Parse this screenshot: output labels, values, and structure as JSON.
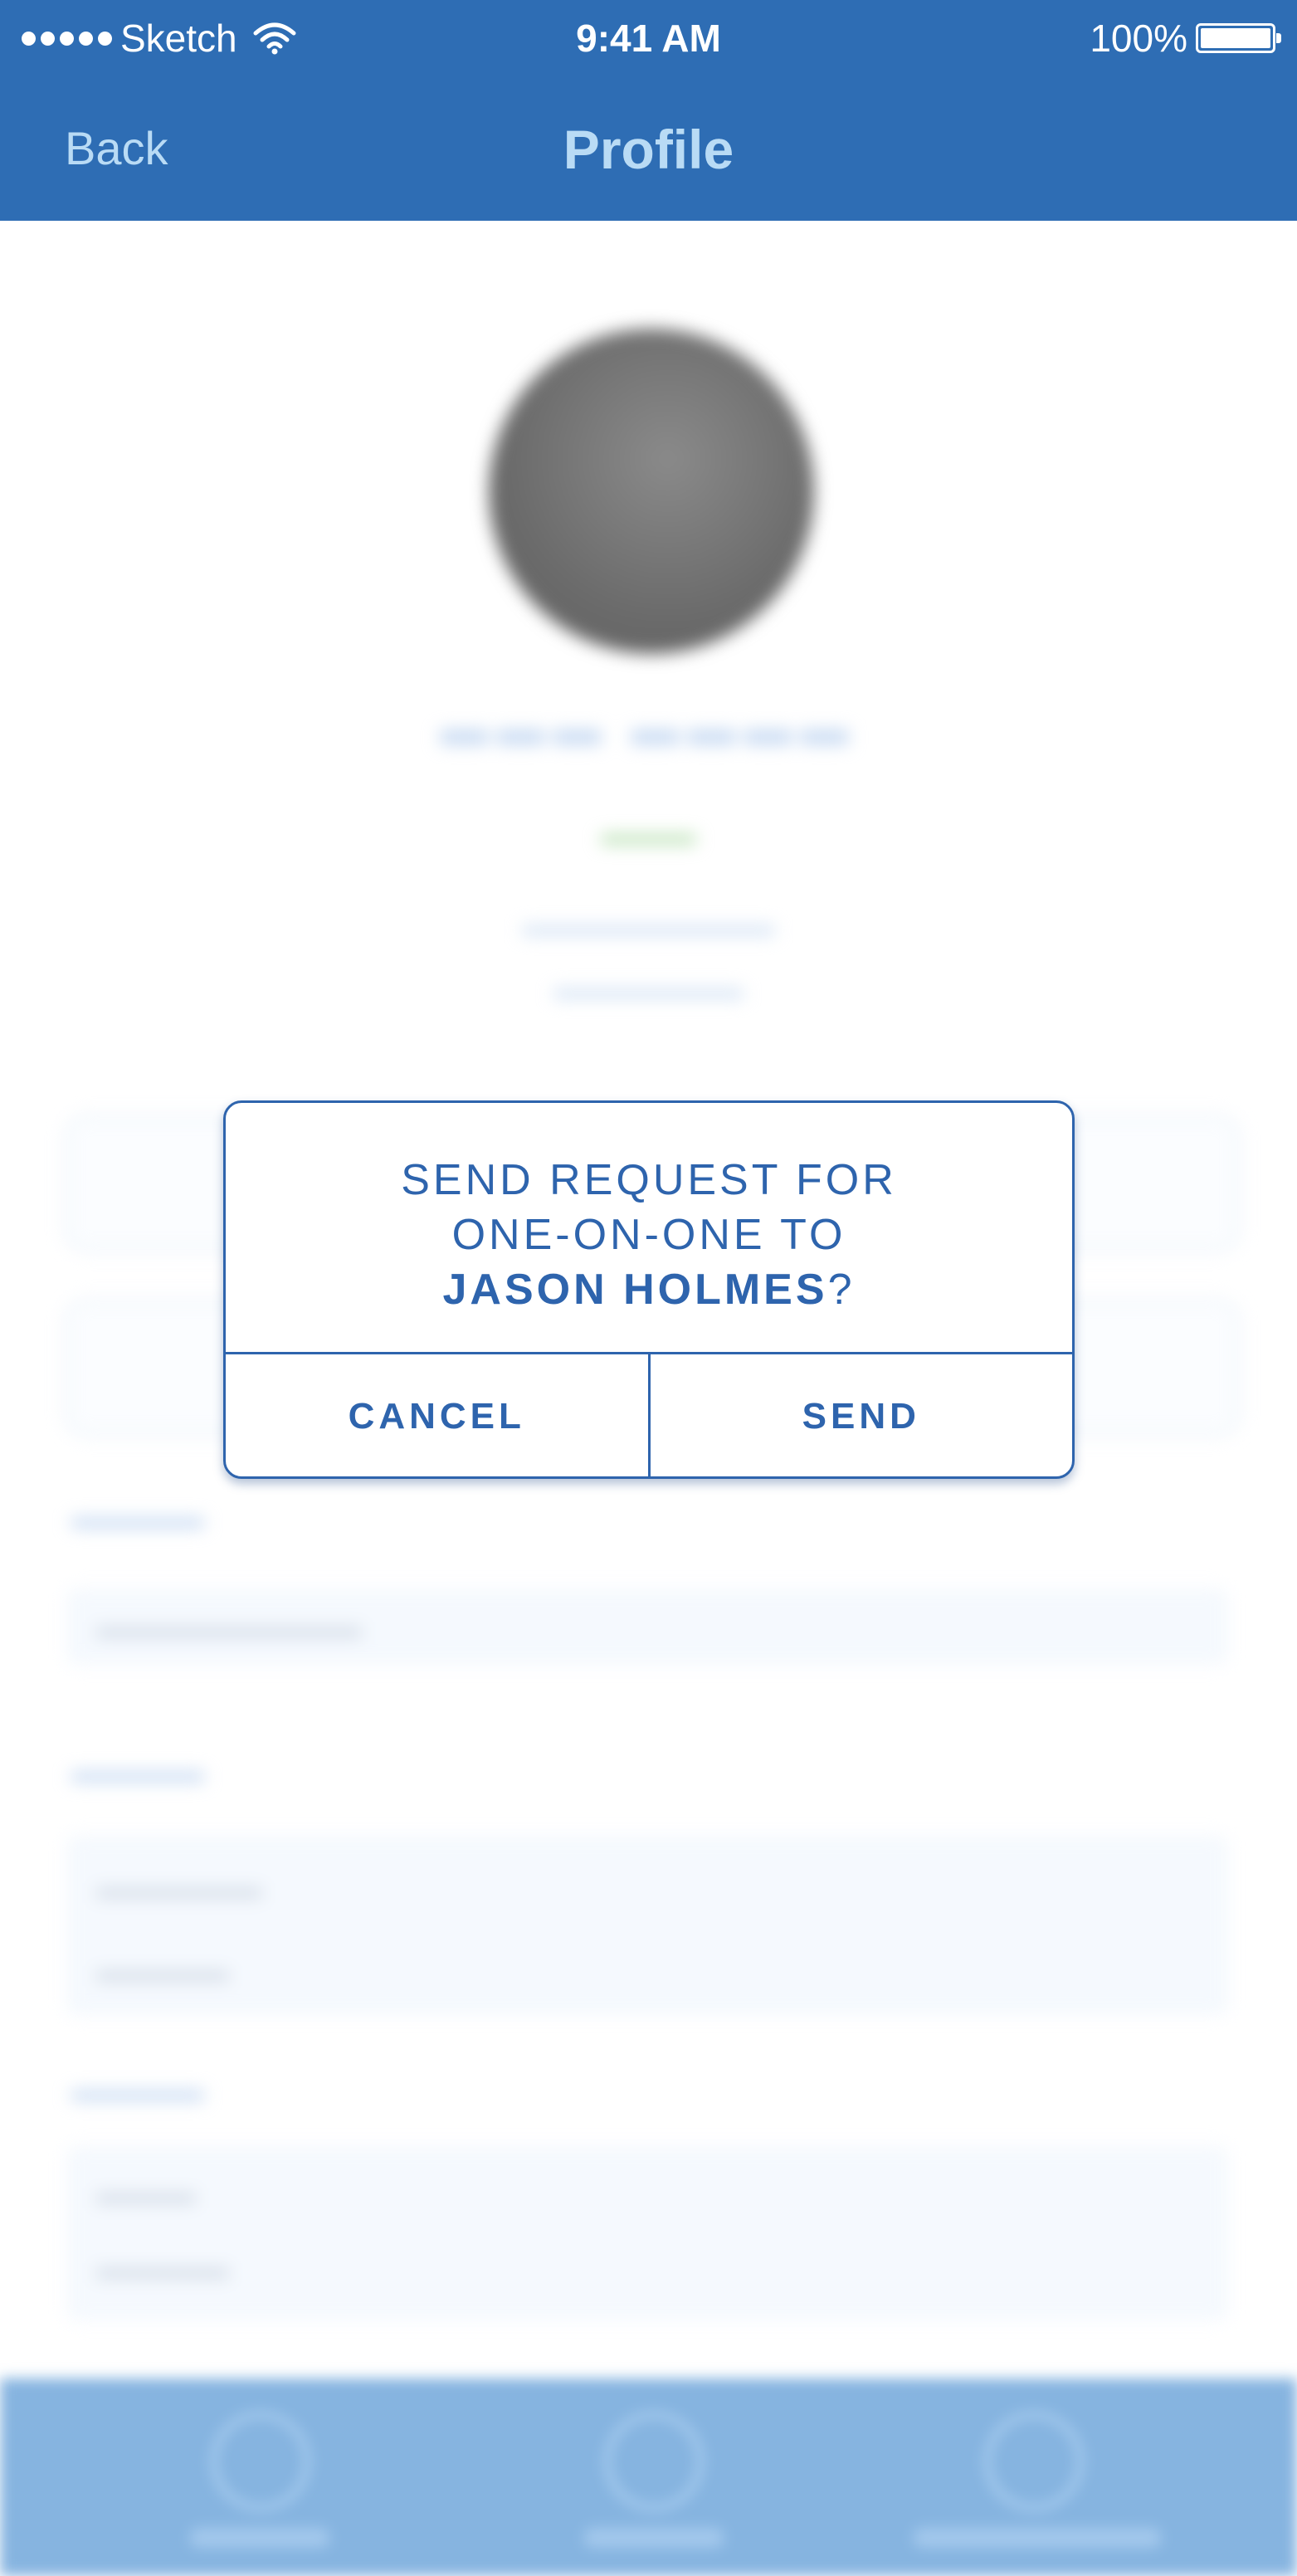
{
  "status_bar": {
    "carrier": "Sketch",
    "time": "9:41 AM",
    "battery": "100%",
    "signal_icon": "signal-dots-icon",
    "wifi_icon": "wifi-icon",
    "battery_icon": "battery-icon"
  },
  "nav": {
    "back_label": "Back",
    "title": "Profile"
  },
  "dialog": {
    "line1": "SEND REQUEST FOR",
    "line2": "ONE-ON-ONE TO",
    "name": "JASON HOLMES",
    "suffix": "?",
    "cancel_label": "CANCEL",
    "send_label": "SEND"
  },
  "colors": {
    "accent": "#2e6db4",
    "dialog_text": "#2e64ad",
    "tab_bar": "#86b4e0"
  }
}
